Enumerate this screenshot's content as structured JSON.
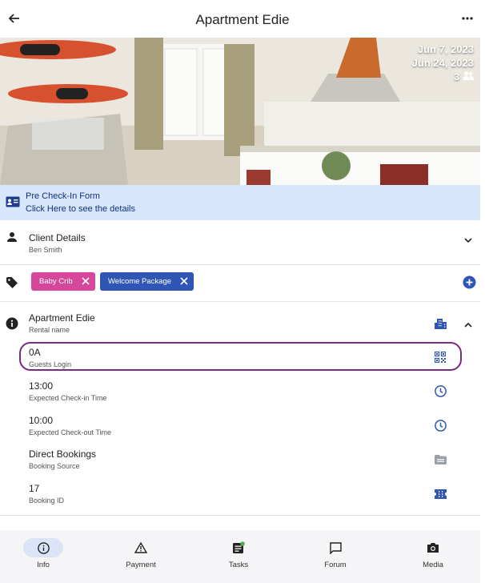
{
  "header": {
    "title": "Apartment Edie"
  },
  "hero": {
    "start_date": "Jun 7, 2023",
    "end_date": "Jun 24, 2023",
    "guest_count": "3"
  },
  "checkin": {
    "title": "Pre Check-In Form",
    "subtitle": "Click Here to see the details"
  },
  "client": {
    "label": "Client Details",
    "value": "Ben Smith"
  },
  "tags": [
    {
      "label": "Baby Crib",
      "color": "#d6469b"
    },
    {
      "label": "Welcome Package",
      "color": "#2f56b5"
    }
  ],
  "details": [
    {
      "value": "Apartment Edie",
      "label": "Rental name",
      "icon": "building-icon"
    },
    {
      "value": "0A",
      "label": "Guests Login",
      "icon": "qr-code-icon"
    },
    {
      "value": "13:00",
      "label": "Expected Check-in Time",
      "icon": "clock-icon"
    },
    {
      "value": "10:00",
      "label": "Expected Check-out Time",
      "icon": "clock-icon"
    },
    {
      "value": "Direct Bookings",
      "label": "Booking Source",
      "icon": "folder-icon"
    },
    {
      "value": "17",
      "label": "Booking ID",
      "icon": "ticket-icon"
    }
  ],
  "nav": [
    {
      "label": "Info",
      "icon": "info-icon",
      "active": true
    },
    {
      "label": "Payment",
      "icon": "warning-icon"
    },
    {
      "label": "Tasks",
      "icon": "tasks-icon"
    },
    {
      "label": "Forum",
      "icon": "chat-icon"
    },
    {
      "label": "Media",
      "icon": "camera-icon"
    }
  ],
  "colors": {
    "accent": "#3a5fc8",
    "checkin_bg": "#d6e6fb",
    "highlight": "#7a2a82",
    "active_pill": "#dbe4f7"
  }
}
